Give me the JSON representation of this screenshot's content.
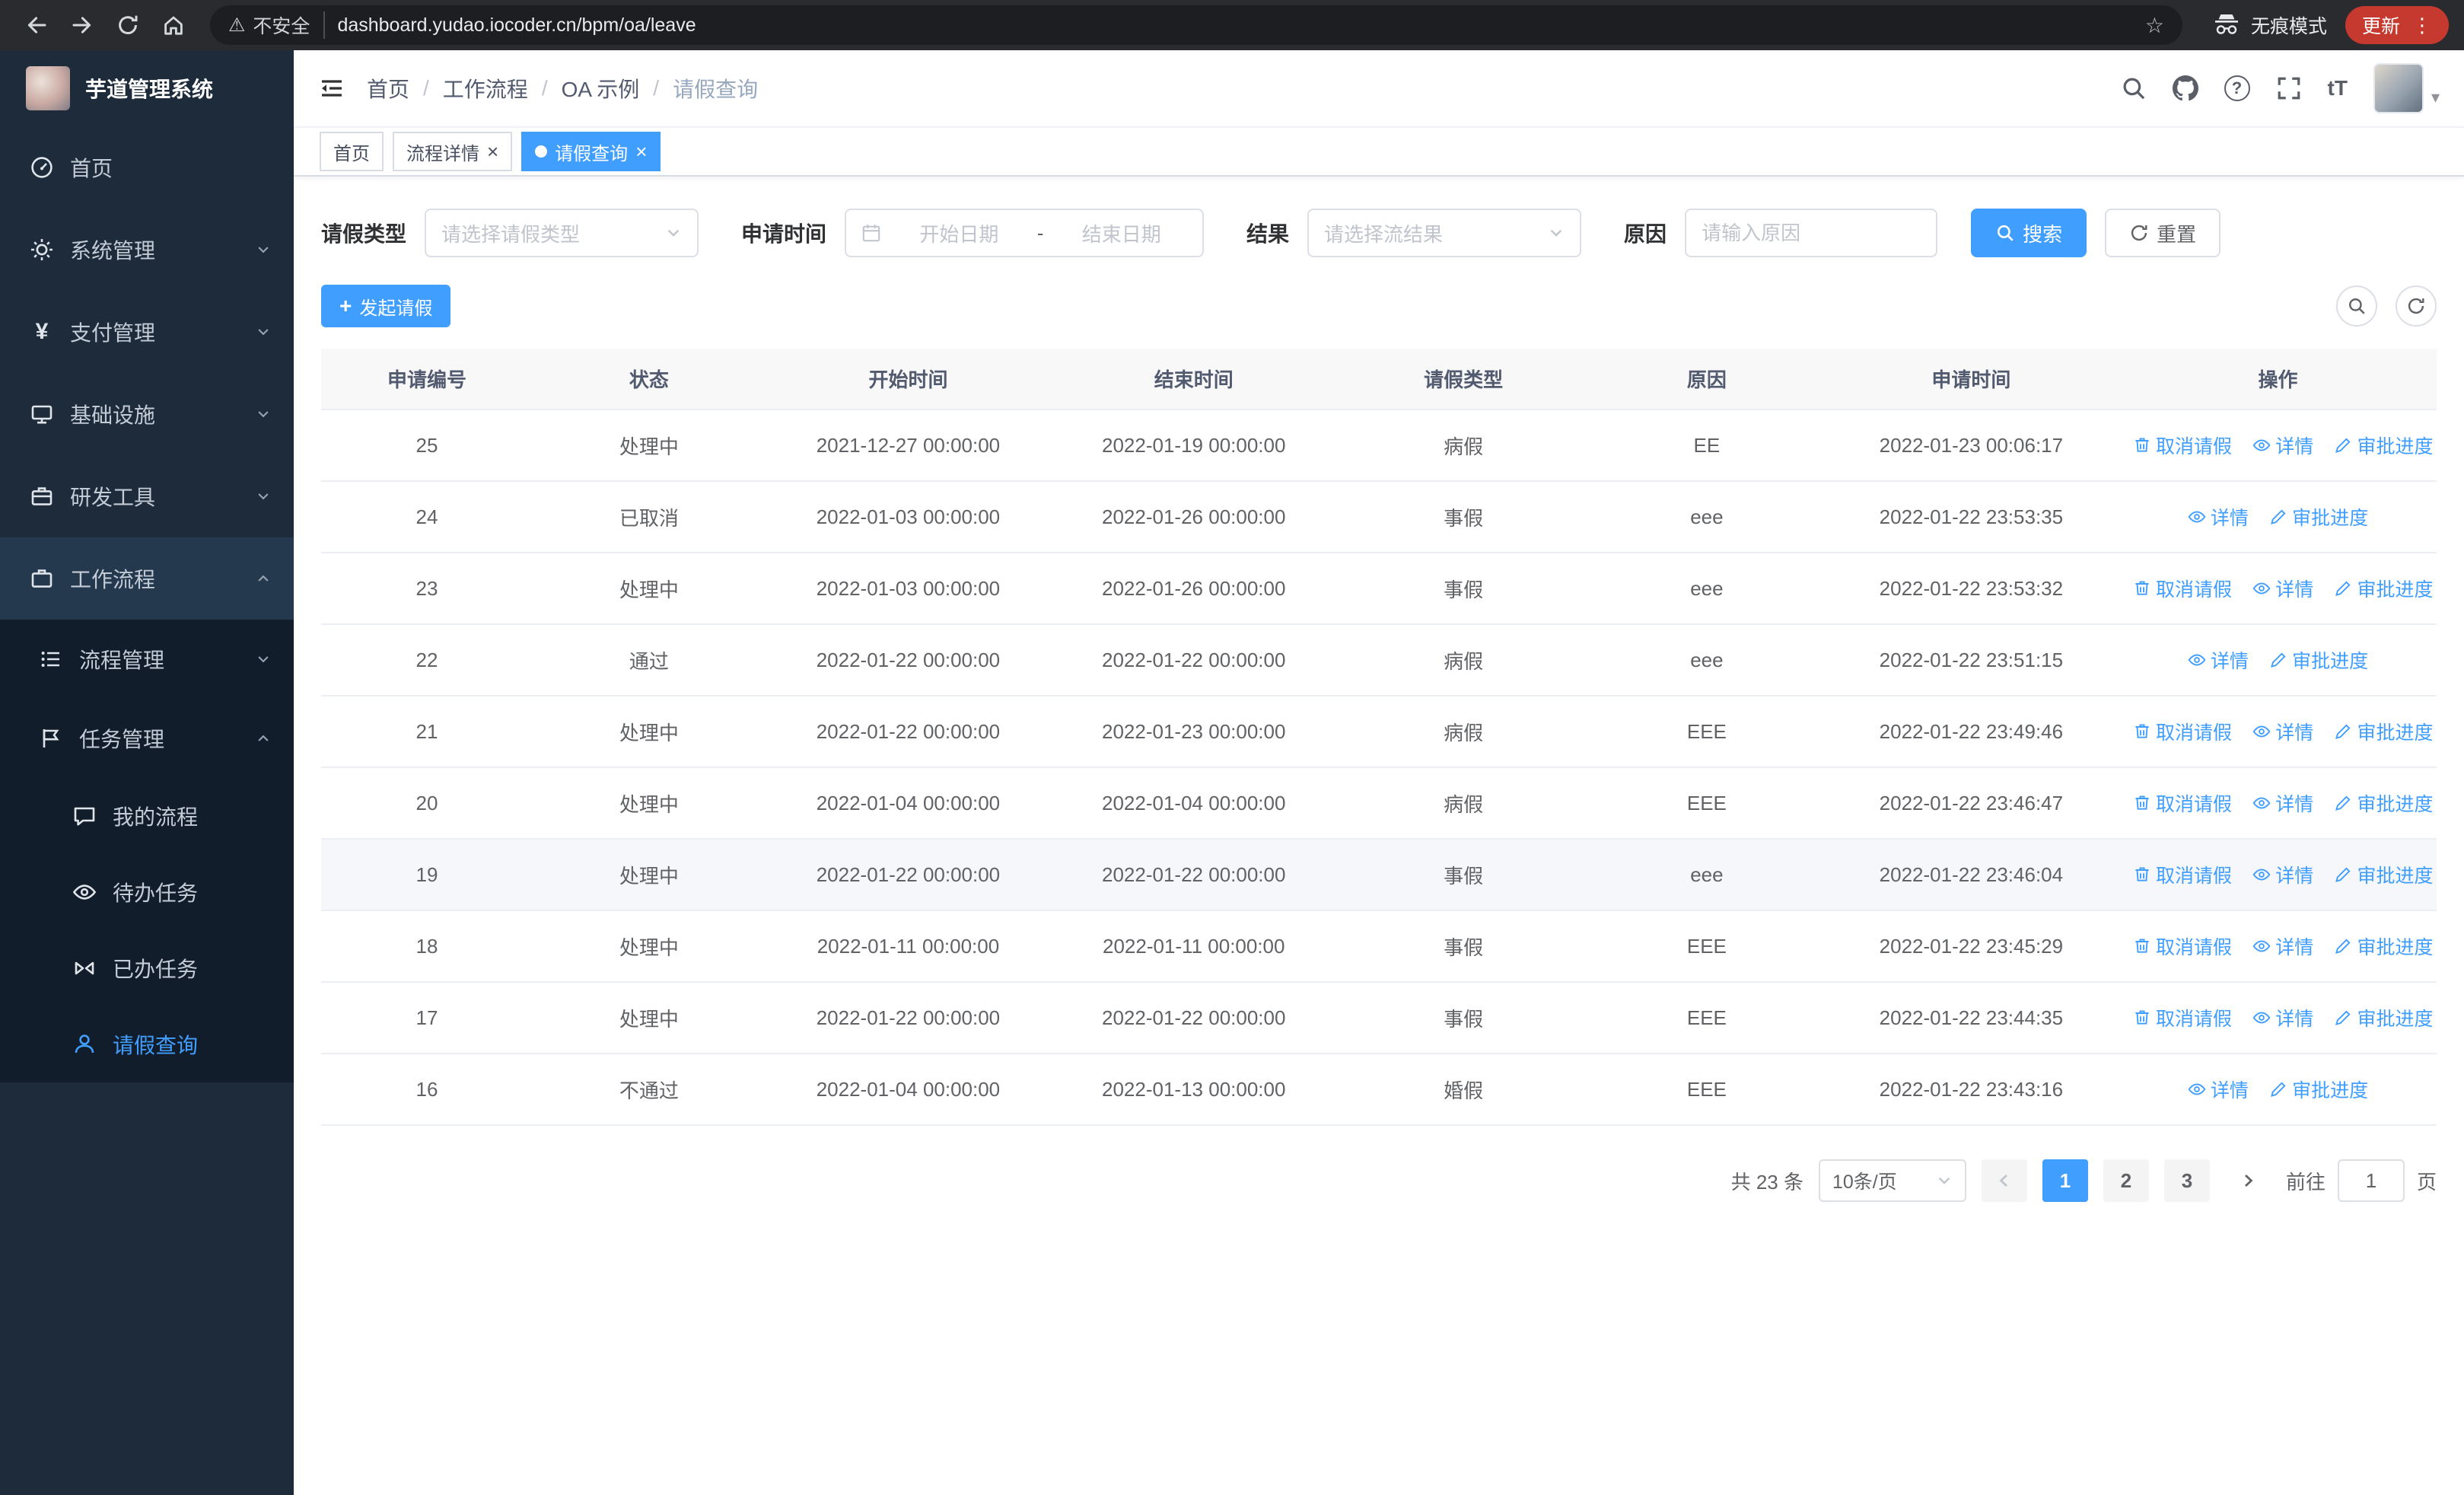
{
  "colors": {
    "accent": "#409eff",
    "sidebar_bg": "#1d2b3a",
    "update_chip": "#c5392f"
  },
  "glyphs": {
    "warning": "⚠",
    "star": "☆",
    "dots": "⋮",
    "caret": "▾",
    "close": "×",
    "plus": "+",
    "yen": "¥",
    "font_size": "tT",
    "question": "?"
  },
  "browser": {
    "security_label": "不安全",
    "url": "dashboard.yudao.iocoder.cn/bpm/oa/leave",
    "incognito_label": "无痕模式",
    "update_label": "更新"
  },
  "sidebar": {
    "app_title": "芋道管理系统",
    "menu": [
      {
        "label": "首页"
      },
      {
        "label": "系统管理"
      },
      {
        "label": "支付管理"
      },
      {
        "label": "基础设施"
      },
      {
        "label": "研发工具"
      },
      {
        "label": "工作流程"
      }
    ],
    "submenu": [
      {
        "label": "流程管理"
      },
      {
        "label": "任务管理"
      }
    ],
    "task_children": [
      {
        "label": "我的流程"
      },
      {
        "label": "待办任务"
      },
      {
        "label": "已办任务"
      },
      {
        "label": "请假查询"
      }
    ]
  },
  "header": {
    "separator": "/",
    "breadcrumb": [
      {
        "label": "首页"
      },
      {
        "label": "工作流程"
      },
      {
        "label": "OA 示例"
      },
      {
        "label": "请假查询"
      }
    ]
  },
  "tabs": [
    {
      "label": "首页"
    },
    {
      "label": "流程详情"
    },
    {
      "label": "请假查询"
    }
  ],
  "filters": {
    "type_label": "请假类型",
    "type_placeholder": "请选择请假类型",
    "time_label": "申请时间",
    "start_placeholder": "开始日期",
    "range_separator": "-",
    "end_placeholder": "结束日期",
    "result_label": "结果",
    "result_placeholder": "请选择流结果",
    "reason_label": "原因",
    "reason_placeholder": "请输入原因",
    "search_label": "搜索",
    "reset_label": "重置"
  },
  "toolbar": {
    "create_label": "发起请假"
  },
  "table": {
    "columns": [
      "申请编号",
      "状态",
      "开始时间",
      "结束时间",
      "请假类型",
      "原因",
      "申请时间",
      "操作"
    ],
    "action_labels": {
      "cancel": "取消请假",
      "detail": "详情",
      "progress": "审批进度"
    },
    "rows": [
      {
        "id": "25",
        "status": "处理中",
        "start": "2021-12-27 00:00:00",
        "end": "2022-01-19 00:00:00",
        "type": "病假",
        "reason": "EE",
        "applied": "2022-01-23 00:06:17",
        "can_cancel": true
      },
      {
        "id": "24",
        "status": "已取消",
        "start": "2022-01-03 00:00:00",
        "end": "2022-01-26 00:00:00",
        "type": "事假",
        "reason": "eee",
        "applied": "2022-01-22 23:53:35",
        "can_cancel": false
      },
      {
        "id": "23",
        "status": "处理中",
        "start": "2022-01-03 00:00:00",
        "end": "2022-01-26 00:00:00",
        "type": "事假",
        "reason": "eee",
        "applied": "2022-01-22 23:53:32",
        "can_cancel": true
      },
      {
        "id": "22",
        "status": "通过",
        "start": "2022-01-22 00:00:00",
        "end": "2022-01-22 00:00:00",
        "type": "病假",
        "reason": "eee",
        "applied": "2022-01-22 23:51:15",
        "can_cancel": false
      },
      {
        "id": "21",
        "status": "处理中",
        "start": "2022-01-22 00:00:00",
        "end": "2022-01-23 00:00:00",
        "type": "病假",
        "reason": "EEE",
        "applied": "2022-01-22 23:49:46",
        "can_cancel": true
      },
      {
        "id": "20",
        "status": "处理中",
        "start": "2022-01-04 00:00:00",
        "end": "2022-01-04 00:00:00",
        "type": "病假",
        "reason": "EEE",
        "applied": "2022-01-22 23:46:47",
        "can_cancel": true
      },
      {
        "id": "19",
        "status": "处理中",
        "start": "2022-01-22 00:00:00",
        "end": "2022-01-22 00:00:00",
        "type": "事假",
        "reason": "eee",
        "applied": "2022-01-22 23:46:04",
        "can_cancel": true,
        "highlight": true
      },
      {
        "id": "18",
        "status": "处理中",
        "start": "2022-01-11 00:00:00",
        "end": "2022-01-11 00:00:00",
        "type": "事假",
        "reason": "EEE",
        "applied": "2022-01-22 23:45:29",
        "can_cancel": true
      },
      {
        "id": "17",
        "status": "处理中",
        "start": "2022-01-22 00:00:00",
        "end": "2022-01-22 00:00:00",
        "type": "事假",
        "reason": "EEE",
        "applied": "2022-01-22 23:44:35",
        "can_cancel": true
      },
      {
        "id": "16",
        "status": "不通过",
        "start": "2022-01-04 00:00:00",
        "end": "2022-01-13 00:00:00",
        "type": "婚假",
        "reason": "EEE",
        "applied": "2022-01-22 23:43:16",
        "can_cancel": false
      }
    ]
  },
  "pagination": {
    "total_label": "共 23 条",
    "page_size_label": "10条/页",
    "pages": [
      "1",
      "2",
      "3"
    ],
    "goto_label": "前往",
    "goto_value": "1",
    "goto_unit": "页"
  }
}
